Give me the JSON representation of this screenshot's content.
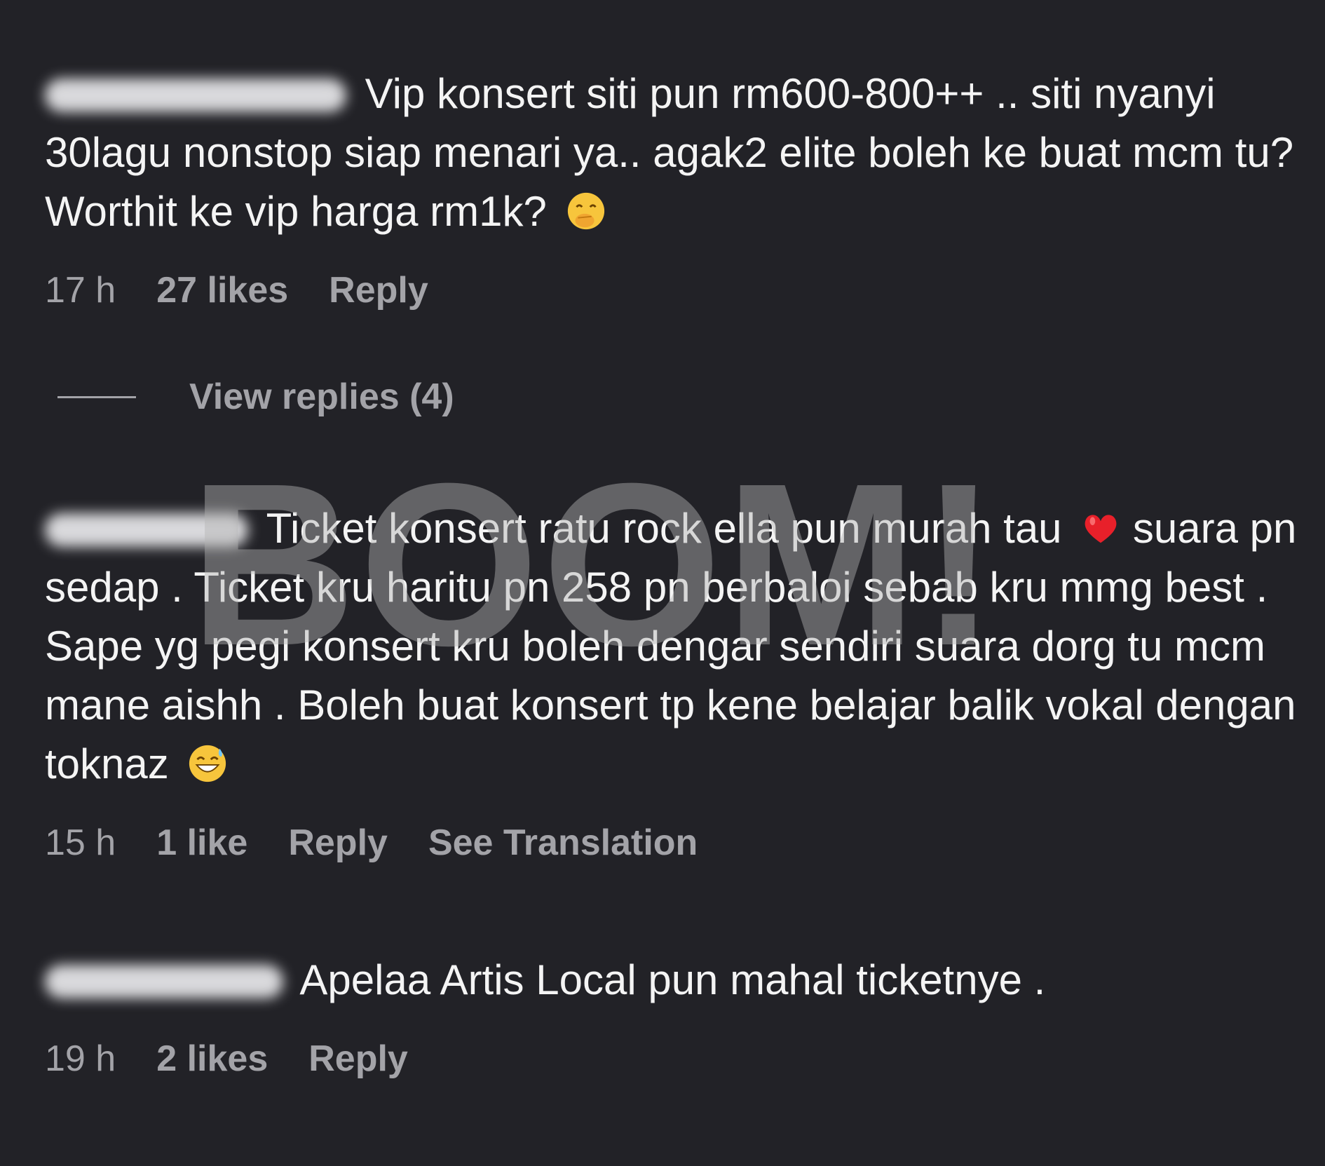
{
  "comments": [
    {
      "text_parts": [
        "Vip konsert siti pun rm600-800++ .. siti nyanyi 30lagu nonstop siap menari ya.. agak2 elite boleh ke buat mcm tu? Worthit ke vip harga rm1k?"
      ],
      "emoji": "hand-over-mouth-emoji",
      "time": "17 h",
      "likes": "27 likes",
      "reply": "Reply"
    },
    {
      "text_parts": [
        "Ticket konsert ratu rock ella pun murah tau",
        "suara pn sedap . Ticket kru haritu pn 258 pn berbaloi sebab kru mmg best . Sape yg pegi konsert kru boleh dengar sendiri suara dorg tu mcm mane aishh . Boleh buat konsert tp kene belajar balik vokal dengan toknaz"
      ],
      "emojis": [
        "red-heart-emoji",
        "grinning-sweat-emoji"
      ],
      "time": "15 h",
      "likes": "1 like",
      "reply": "Reply",
      "translate": "See Translation"
    },
    {
      "text_parts": [
        "Apelaa Artis Local pun mahal ticketnye ."
      ],
      "time": "19 h",
      "likes": "2 likes",
      "reply": "Reply"
    }
  ],
  "view_replies": "View replies (4)",
  "watermark": "BOOM!"
}
